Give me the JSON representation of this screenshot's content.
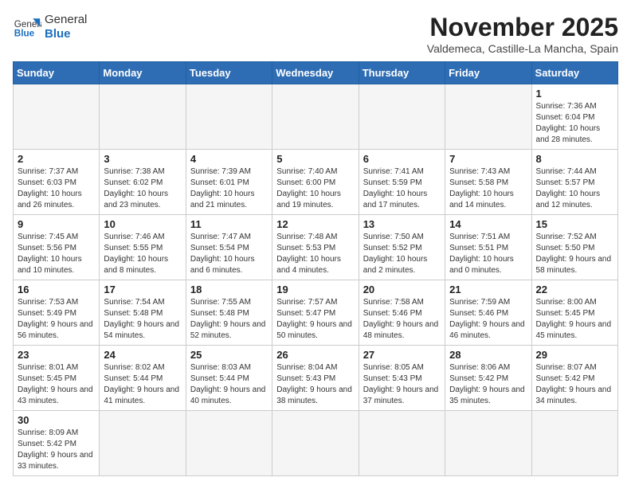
{
  "header": {
    "logo_general": "General",
    "logo_blue": "Blue",
    "month": "November 2025",
    "location": "Valdemeca, Castille-La Mancha, Spain"
  },
  "weekdays": [
    "Sunday",
    "Monday",
    "Tuesday",
    "Wednesday",
    "Thursday",
    "Friday",
    "Saturday"
  ],
  "weeks": [
    [
      {
        "day": "",
        "info": ""
      },
      {
        "day": "",
        "info": ""
      },
      {
        "day": "",
        "info": ""
      },
      {
        "day": "",
        "info": ""
      },
      {
        "day": "",
        "info": ""
      },
      {
        "day": "",
        "info": ""
      },
      {
        "day": "1",
        "info": "Sunrise: 7:36 AM\nSunset: 6:04 PM\nDaylight: 10 hours and 28 minutes."
      }
    ],
    [
      {
        "day": "2",
        "info": "Sunrise: 7:37 AM\nSunset: 6:03 PM\nDaylight: 10 hours and 26 minutes."
      },
      {
        "day": "3",
        "info": "Sunrise: 7:38 AM\nSunset: 6:02 PM\nDaylight: 10 hours and 23 minutes."
      },
      {
        "day": "4",
        "info": "Sunrise: 7:39 AM\nSunset: 6:01 PM\nDaylight: 10 hours and 21 minutes."
      },
      {
        "day": "5",
        "info": "Sunrise: 7:40 AM\nSunset: 6:00 PM\nDaylight: 10 hours and 19 minutes."
      },
      {
        "day": "6",
        "info": "Sunrise: 7:41 AM\nSunset: 5:59 PM\nDaylight: 10 hours and 17 minutes."
      },
      {
        "day": "7",
        "info": "Sunrise: 7:43 AM\nSunset: 5:58 PM\nDaylight: 10 hours and 14 minutes."
      },
      {
        "day": "8",
        "info": "Sunrise: 7:44 AM\nSunset: 5:57 PM\nDaylight: 10 hours and 12 minutes."
      }
    ],
    [
      {
        "day": "9",
        "info": "Sunrise: 7:45 AM\nSunset: 5:56 PM\nDaylight: 10 hours and 10 minutes."
      },
      {
        "day": "10",
        "info": "Sunrise: 7:46 AM\nSunset: 5:55 PM\nDaylight: 10 hours and 8 minutes."
      },
      {
        "day": "11",
        "info": "Sunrise: 7:47 AM\nSunset: 5:54 PM\nDaylight: 10 hours and 6 minutes."
      },
      {
        "day": "12",
        "info": "Sunrise: 7:48 AM\nSunset: 5:53 PM\nDaylight: 10 hours and 4 minutes."
      },
      {
        "day": "13",
        "info": "Sunrise: 7:50 AM\nSunset: 5:52 PM\nDaylight: 10 hours and 2 minutes."
      },
      {
        "day": "14",
        "info": "Sunrise: 7:51 AM\nSunset: 5:51 PM\nDaylight: 10 hours and 0 minutes."
      },
      {
        "day": "15",
        "info": "Sunrise: 7:52 AM\nSunset: 5:50 PM\nDaylight: 9 hours and 58 minutes."
      }
    ],
    [
      {
        "day": "16",
        "info": "Sunrise: 7:53 AM\nSunset: 5:49 PM\nDaylight: 9 hours and 56 minutes."
      },
      {
        "day": "17",
        "info": "Sunrise: 7:54 AM\nSunset: 5:48 PM\nDaylight: 9 hours and 54 minutes."
      },
      {
        "day": "18",
        "info": "Sunrise: 7:55 AM\nSunset: 5:48 PM\nDaylight: 9 hours and 52 minutes."
      },
      {
        "day": "19",
        "info": "Sunrise: 7:57 AM\nSunset: 5:47 PM\nDaylight: 9 hours and 50 minutes."
      },
      {
        "day": "20",
        "info": "Sunrise: 7:58 AM\nSunset: 5:46 PM\nDaylight: 9 hours and 48 minutes."
      },
      {
        "day": "21",
        "info": "Sunrise: 7:59 AM\nSunset: 5:46 PM\nDaylight: 9 hours and 46 minutes."
      },
      {
        "day": "22",
        "info": "Sunrise: 8:00 AM\nSunset: 5:45 PM\nDaylight: 9 hours and 45 minutes."
      }
    ],
    [
      {
        "day": "23",
        "info": "Sunrise: 8:01 AM\nSunset: 5:45 PM\nDaylight: 9 hours and 43 minutes."
      },
      {
        "day": "24",
        "info": "Sunrise: 8:02 AM\nSunset: 5:44 PM\nDaylight: 9 hours and 41 minutes."
      },
      {
        "day": "25",
        "info": "Sunrise: 8:03 AM\nSunset: 5:44 PM\nDaylight: 9 hours and 40 minutes."
      },
      {
        "day": "26",
        "info": "Sunrise: 8:04 AM\nSunset: 5:43 PM\nDaylight: 9 hours and 38 minutes."
      },
      {
        "day": "27",
        "info": "Sunrise: 8:05 AM\nSunset: 5:43 PM\nDaylight: 9 hours and 37 minutes."
      },
      {
        "day": "28",
        "info": "Sunrise: 8:06 AM\nSunset: 5:42 PM\nDaylight: 9 hours and 35 minutes."
      },
      {
        "day": "29",
        "info": "Sunrise: 8:07 AM\nSunset: 5:42 PM\nDaylight: 9 hours and 34 minutes."
      }
    ],
    [
      {
        "day": "30",
        "info": "Sunrise: 8:09 AM\nSunset: 5:42 PM\nDaylight: 9 hours and 33 minutes."
      },
      {
        "day": "",
        "info": ""
      },
      {
        "day": "",
        "info": ""
      },
      {
        "day": "",
        "info": ""
      },
      {
        "day": "",
        "info": ""
      },
      {
        "day": "",
        "info": ""
      },
      {
        "day": "",
        "info": ""
      }
    ]
  ]
}
